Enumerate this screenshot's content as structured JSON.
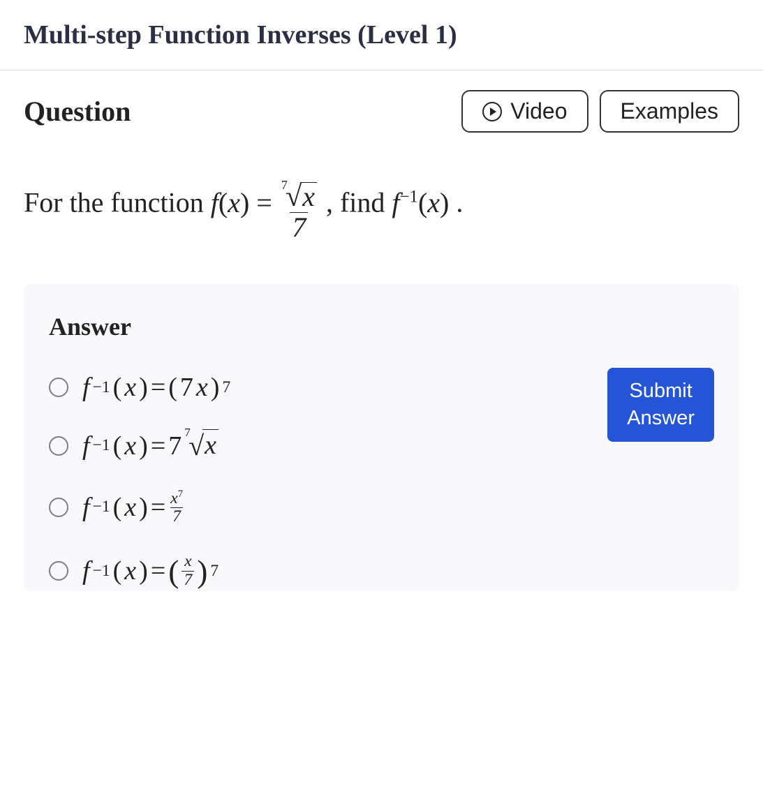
{
  "header": {
    "title": "Multi-step Function Inverses (Level 1)"
  },
  "question": {
    "label": "Question",
    "video_button": "Video",
    "examples_button": "Examples",
    "prompt_prefix": "For the function ",
    "prompt_find": ", find ",
    "prompt_suffix": ".",
    "func_left": "f(x) = ",
    "func_rhs_num_root_index": "7",
    "func_rhs_num_root_radicand": "x",
    "func_rhs_den": "7",
    "inverse": "f⁻¹(x)"
  },
  "answer": {
    "label": "Answer",
    "submit": "Submit\nAnswer",
    "options": [
      {
        "lhs": "f⁻¹(x) = ",
        "type": "power",
        "base_open": "(",
        "base_inner": "7x",
        "base_close": ")",
        "exp": "7"
      },
      {
        "lhs": "f⁻¹(x) = ",
        "type": "root",
        "coeff": "7",
        "root_index": "7",
        "radicand": "x"
      },
      {
        "lhs": "f⁻¹(x) = ",
        "type": "frac",
        "num": "x",
        "num_exp": "7",
        "den": "7"
      },
      {
        "lhs": "f⁻¹(x) = ",
        "type": "fracpow",
        "open": "(",
        "num": "x",
        "den": "7",
        "close": ")",
        "exp": "7"
      }
    ]
  }
}
